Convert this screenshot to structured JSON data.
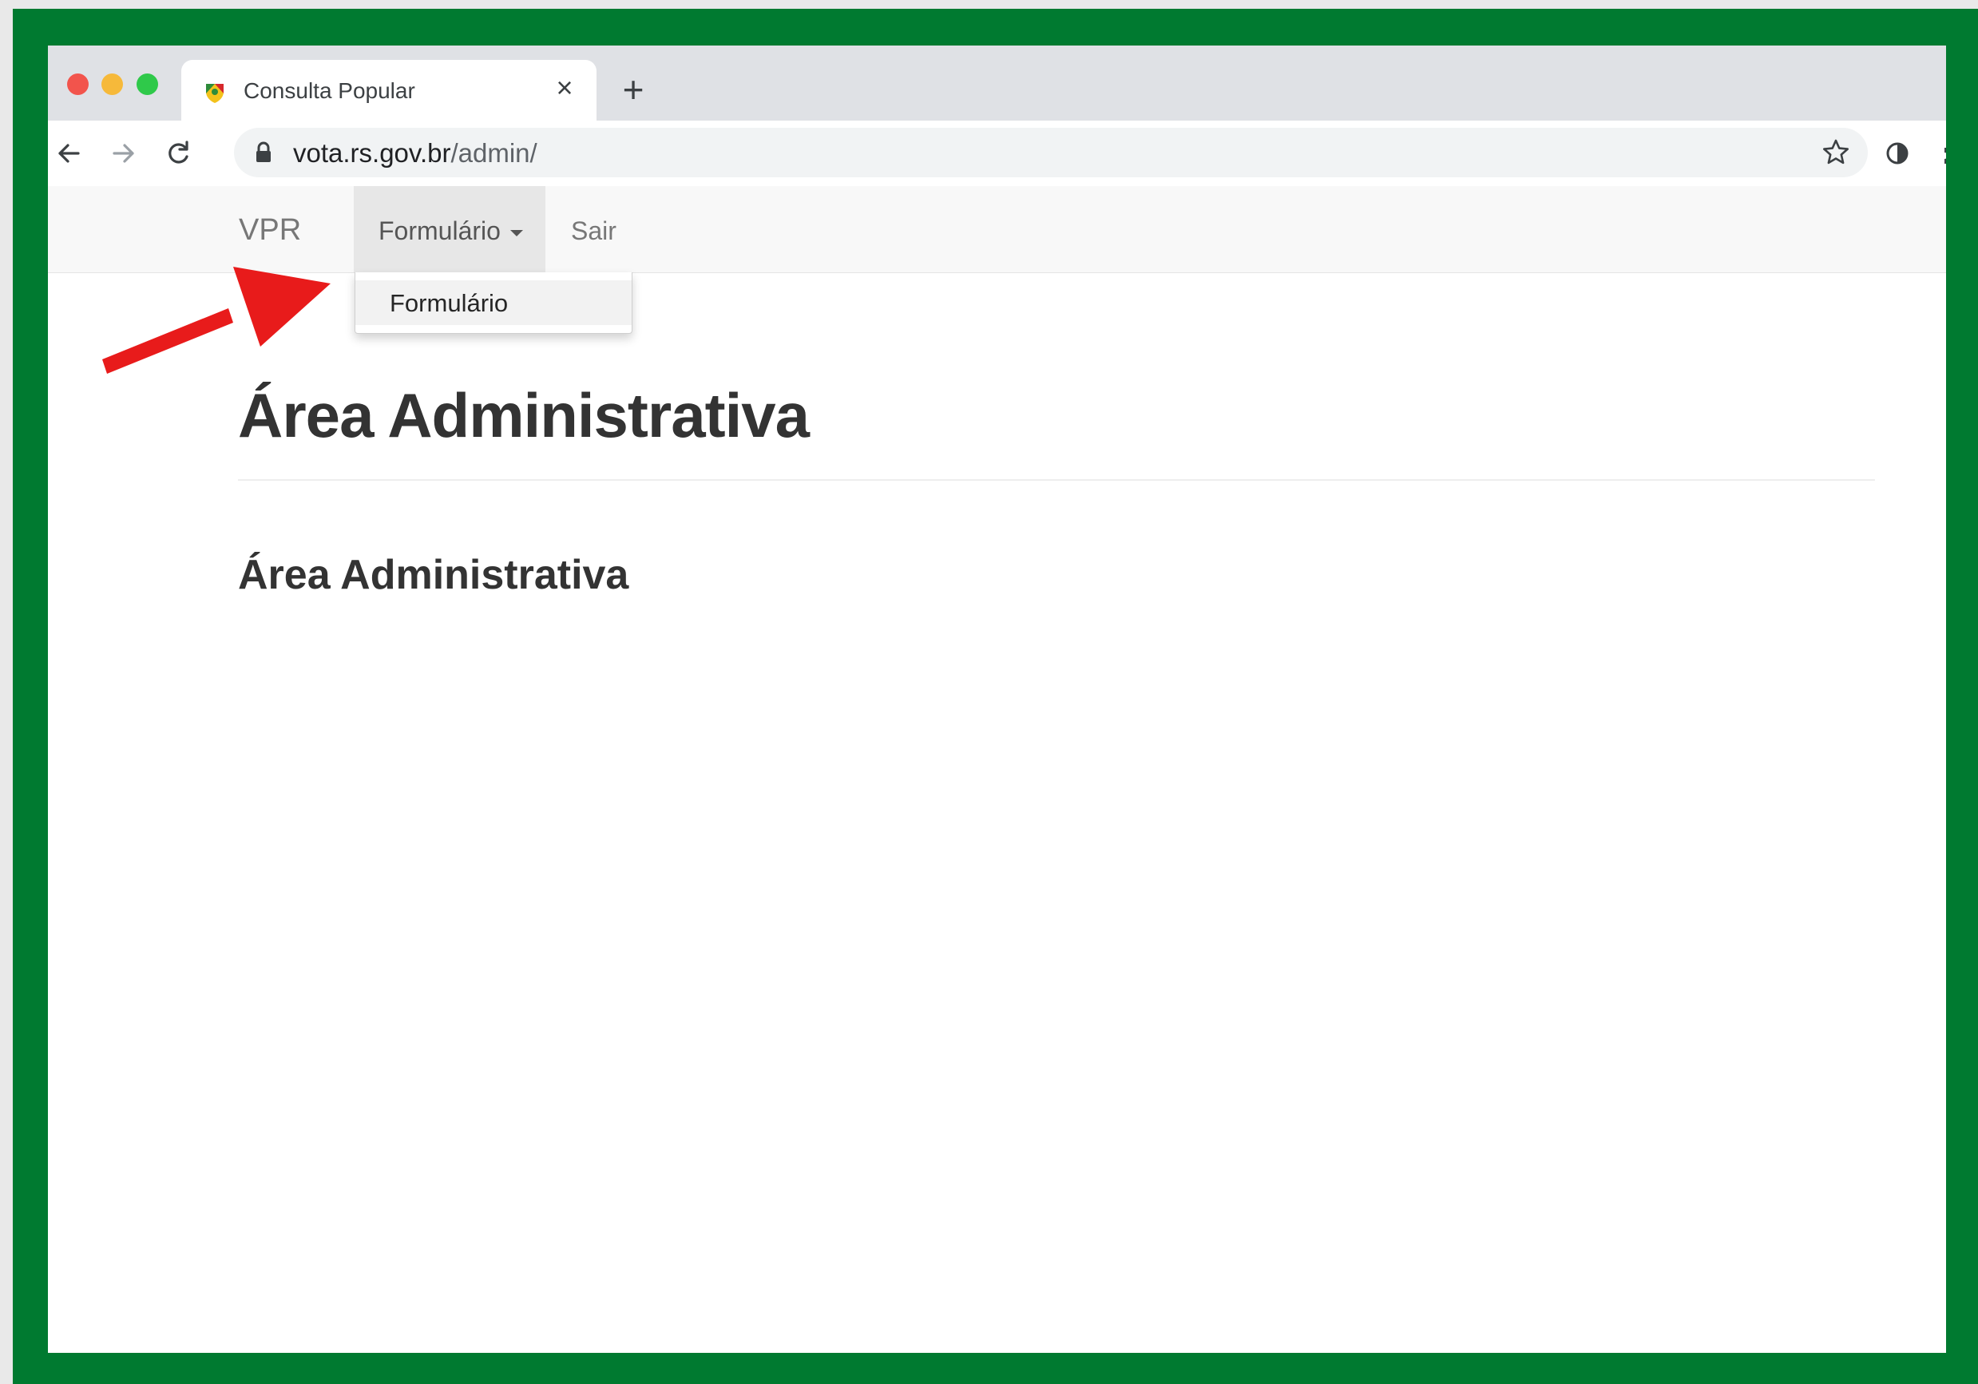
{
  "browser": {
    "tab": {
      "title": "Consulta Popular",
      "close_glyph": "×",
      "favicon": "brasao-rs-favicon"
    },
    "new_tab_glyph": "+",
    "address": {
      "host": "vota.rs.gov.br",
      "path": "/admin/"
    },
    "icons": {
      "back": "arrow-left-icon",
      "forward": "arrow-right-icon",
      "reload": "reload-icon",
      "lock": "lock-icon",
      "bookmark": "star-icon",
      "extension_1": "circle-extension-icon",
      "extensions": "puzzle-icon"
    }
  },
  "navbar": {
    "brand": "VPR",
    "dropdown_label": "Formulário",
    "link_sair": "Sair"
  },
  "dropdown_menu": {
    "items": [
      "Formulário"
    ]
  },
  "content": {
    "page_title": "Área Administrativa",
    "section_title": "Área Administrativa"
  },
  "annotation": {
    "arrow_color": "#e81b1b"
  },
  "colors": {
    "frame": "#007a30",
    "navbar_bg": "#f8f8f8",
    "active_nav_bg": "#e7e7e7",
    "text_dark": "#333333"
  }
}
